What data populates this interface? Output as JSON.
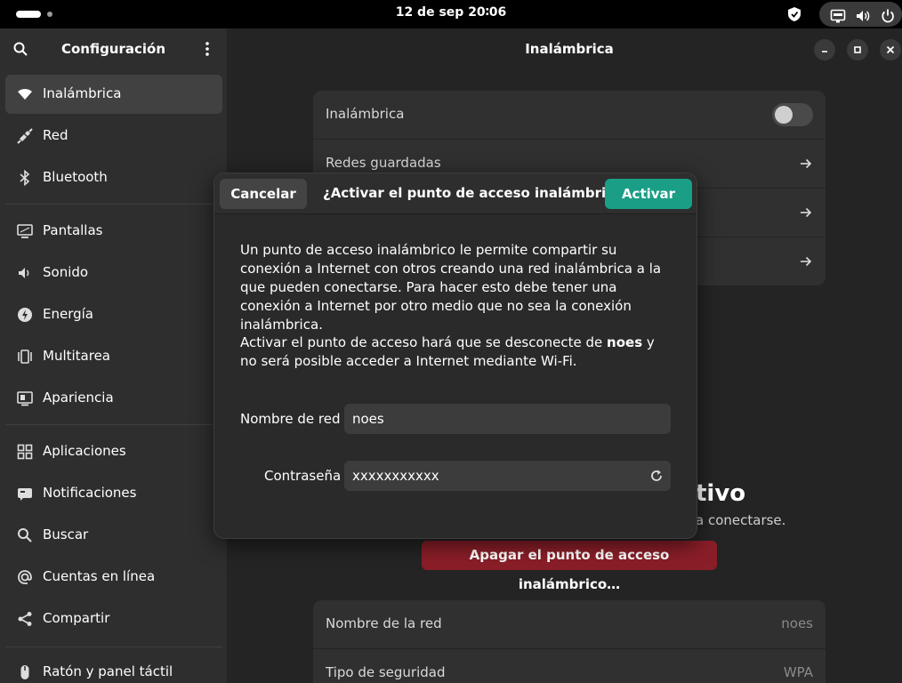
{
  "topbar": {
    "date": "12 de sep",
    "time": "20∶06",
    "icons": [
      "workspace-indicator",
      "shield-icon",
      "network-wired-icon",
      "volume-icon",
      "power-icon"
    ]
  },
  "sidebar": {
    "title": "Configuración",
    "items": [
      {
        "label": "Inalámbrica",
        "icon": "wifi-icon",
        "active": true
      },
      {
        "label": "Red",
        "icon": "network-icon"
      },
      {
        "label": "Bluetooth",
        "icon": "bluetooth-icon"
      },
      {
        "label": "Pantallas",
        "icon": "display-icon"
      },
      {
        "label": "Sonido",
        "icon": "sound-icon"
      },
      {
        "label": "Energía",
        "icon": "power-icon"
      },
      {
        "label": "Multitarea",
        "icon": "multitask-icon"
      },
      {
        "label": "Apariencia",
        "icon": "appearance-icon"
      },
      {
        "label": "Aplicaciones",
        "icon": "apps-icon"
      },
      {
        "label": "Notificaciones",
        "icon": "notifications-icon"
      },
      {
        "label": "Buscar",
        "icon": "search-icon"
      },
      {
        "label": "Cuentas en línea",
        "icon": "online-accounts-icon"
      },
      {
        "label": "Compartir",
        "icon": "share-icon"
      },
      {
        "label": "Ratón y panel táctil",
        "icon": "mouse-icon"
      }
    ]
  },
  "main": {
    "title": "Inalámbrica",
    "wifi_row": "Inalámbrica",
    "saved_networks": "Redes guardadas",
    "hotspot_heading_partial": "tivo",
    "hotspot_sub_partial": "a conectarse.",
    "turn_off_button": "Apagar el punto de acceso inalámbrico…",
    "info_rows": [
      {
        "label": "Nombre de la red",
        "value": "noes"
      },
      {
        "label": "Tipo de seguridad",
        "value": "WPA"
      }
    ]
  },
  "dialog": {
    "cancel_label": "Cancelar",
    "title": "¿Activar el punto de acceso inalámbrico?",
    "activate_label": "Activar",
    "paragraph1": "Un punto de acceso inalámbrico le permite compartir su conexión a Internet con otros creando una red inalámbrica a la que pueden conectarse. Para hacer esto debe tener una conexión a Internet por otro medio que no sea la conexión inalámbrica.",
    "paragraph2_before": "Activar el punto de acceso hará que se desconecte de ",
    "paragraph2_bold": "noes",
    "paragraph2_after": " y no será posible acceder a Internet mediante Wi-Fi.",
    "network_name_label": "Nombre de red",
    "network_name_value": "noes",
    "password_label": "Contraseña",
    "password_value": "xxxxxxxxxxx"
  },
  "colors": {
    "accent": "#1a9e86",
    "destructive": "#8a1e28",
    "sidebar_bg": "#2e2e2e",
    "window_bg": "#242424"
  }
}
